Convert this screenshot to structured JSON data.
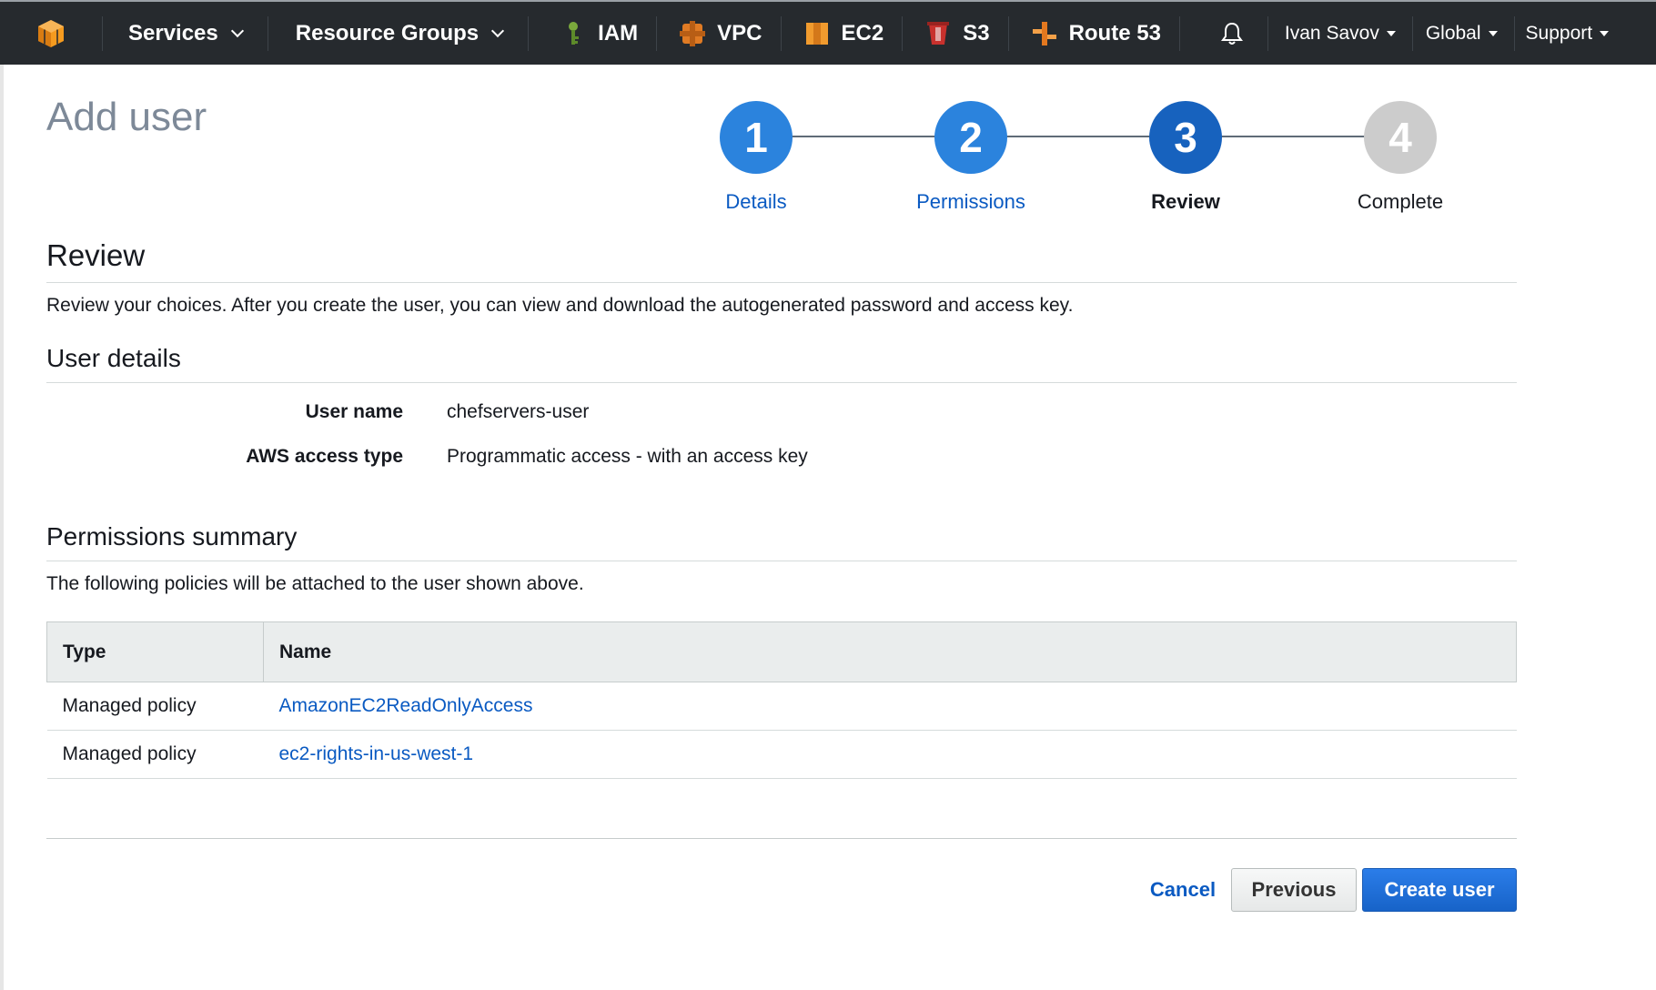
{
  "nav": {
    "services": "Services",
    "resource_groups": "Resource Groups",
    "shortcuts": [
      {
        "label": "IAM",
        "icon": "iam-key-icon",
        "color": "#6a9c2f"
      },
      {
        "label": "VPC",
        "icon": "vpc-icon",
        "color": "#e97b26"
      },
      {
        "label": "EC2",
        "icon": "ec2-icon",
        "color": "#e97b26"
      },
      {
        "label": "S3",
        "icon": "s3-bucket-icon",
        "color": "#c9302c"
      },
      {
        "label": "Route 53",
        "icon": "route53-icon",
        "color": "#e97b26"
      }
    ],
    "user": "Ivan Savov",
    "region": "Global",
    "support": "Support"
  },
  "page": {
    "title": "Add user"
  },
  "wizard": {
    "steps": [
      {
        "number": "1",
        "label": "Details",
        "state": "done"
      },
      {
        "number": "2",
        "label": "Permissions",
        "state": "done"
      },
      {
        "number": "3",
        "label": "Review",
        "state": "active"
      },
      {
        "number": "4",
        "label": "Complete",
        "state": "pending"
      }
    ]
  },
  "review": {
    "heading": "Review",
    "intro": "Review your choices. After you create the user, you can view and download the autogenerated password and access key."
  },
  "user_details": {
    "heading": "User details",
    "rows": [
      {
        "label": "User name",
        "value": "chefservers-user"
      },
      {
        "label": "AWS access type",
        "value": "Programmatic access - with an access key"
      }
    ]
  },
  "permissions": {
    "heading": "Permissions summary",
    "intro": "The following policies will be attached to the user shown above.",
    "columns": [
      "Type",
      "Name"
    ],
    "rows": [
      {
        "type": "Managed policy",
        "name": "AmazonEC2ReadOnlyAccess"
      },
      {
        "type": "Managed policy",
        "name": "ec2-rights-in-us-west-1"
      }
    ]
  },
  "actions": {
    "cancel": "Cancel",
    "previous": "Previous",
    "create": "Create user"
  },
  "colors": {
    "nav_bg": "#262a2e",
    "step_done": "#2b83dd",
    "step_active": "#1762be",
    "step_pending": "#cccccc",
    "link": "#0a5ac2",
    "primary": "#1f6fd8"
  }
}
